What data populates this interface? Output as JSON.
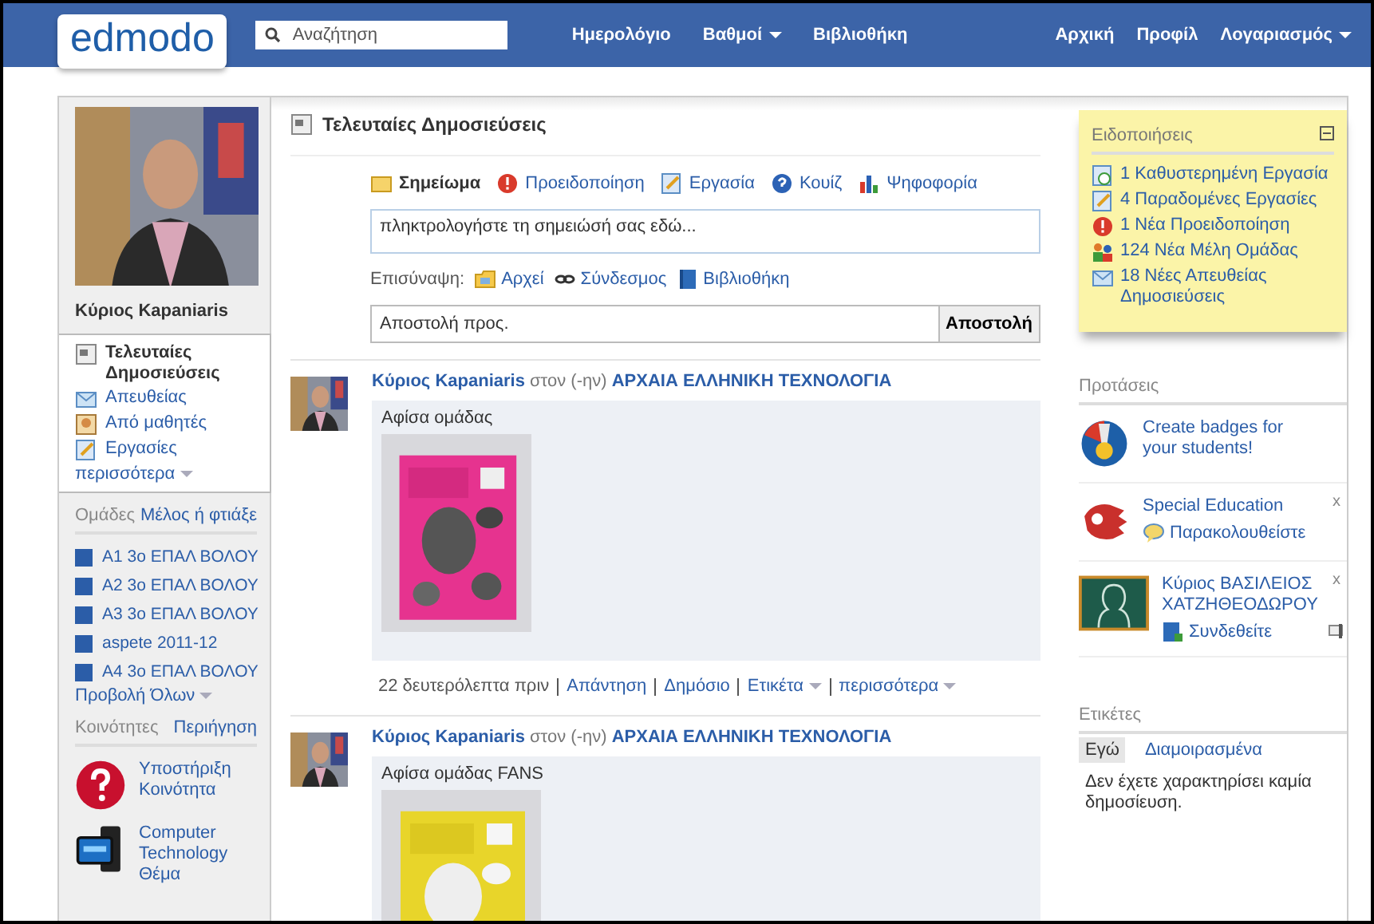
{
  "top_bar": {
    "logo": "edmodo",
    "search": {
      "placeholder": "Αναζήτηση"
    },
    "nav_left": [
      {
        "label": "Ημερολόγιο",
        "dropdown": false
      },
      {
        "label": "Βαθμοί",
        "dropdown": true
      },
      {
        "label": "Βιβλιοθήκη",
        "dropdown": false
      }
    ],
    "nav_right": [
      {
        "label": "Αρχική",
        "dropdown": false
      },
      {
        "label": "Προφίλ",
        "dropdown": false
      },
      {
        "label": "Λογαριασμός",
        "dropdown": true
      }
    ]
  },
  "profile": {
    "name": "Κύριος Kapaniaris"
  },
  "sidebar": {
    "items": [
      {
        "label": "Τελευταίες Δημοσιεύσεις",
        "selected": true,
        "kind": "feed"
      },
      {
        "label": "Απευθείας",
        "selected": false,
        "kind": "mail"
      },
      {
        "label": "Από μαθητές",
        "selected": false,
        "kind": "student"
      },
      {
        "label": "Εργασίες",
        "selected": false,
        "kind": "assignment"
      }
    ],
    "more": "περισσότερα"
  },
  "groups": {
    "title": "Ομάδες",
    "action": "Μέλος ή φτιάξε",
    "items": [
      {
        "name": "Α1 3ο ΕΠΑΛ ΒΟΛΟΥ"
      },
      {
        "name": "Α2 3ο ΕΠΑΛ ΒΟΛΟΥ"
      },
      {
        "name": "Α3 3ο ΕΠΑΛ ΒΟΛΟΥ"
      },
      {
        "name": "aspete 2011-12"
      },
      {
        "name": "Α4 3ο ΕΠΑΛ ΒΟΛΟΥ"
      }
    ],
    "view_all": "Προβολή Όλων"
  },
  "communities": {
    "title": "Κοινότητες",
    "action": "Περιήγηση",
    "items": [
      {
        "name": "Υποστήριξη Κοινότητα",
        "kind": "help"
      },
      {
        "name": "Computer Technology",
        "subtitle": "Θέμα",
        "kind": "computer"
      }
    ]
  },
  "composer": {
    "title": "Τελευταίες Δημοσιεύσεις",
    "tabs": [
      {
        "label": "Σημείωμα",
        "selected": true,
        "kind": "note"
      },
      {
        "label": "Προειδοποίηση",
        "selected": false,
        "kind": "alert"
      },
      {
        "label": "Εργασία",
        "selected": false,
        "kind": "assignment"
      },
      {
        "label": "Κουίζ",
        "selected": false,
        "kind": "quiz"
      },
      {
        "label": "Ψηφοφορία",
        "selected": false,
        "kind": "poll"
      }
    ],
    "placeholder": "πληκτρολογήστε τη σημειώσή σας εδώ...",
    "attach_label": "Επισύναψη:",
    "attachments": [
      {
        "label": "Αρχεί",
        "kind": "file"
      },
      {
        "label": "Σύνδεσμος",
        "kind": "link"
      },
      {
        "label": "Βιβλιοθήκη",
        "kind": "library"
      }
    ],
    "recipient_placeholder": "Αποστολή προς.",
    "send": "Αποστολή"
  },
  "posts": [
    {
      "author": "Κύριος Kapaniaris",
      "connector": "στον (-ην)",
      "group": "ΑΡΧΑΙΑ ΕΛΛΗΝΙΚΗ ΤΕΧΝΟΛΟΓΙΑ",
      "text": "Αφίσα ομάδας",
      "time": "22 δευτερόλεπτα πριν",
      "actions": [
        {
          "label": "Απάντηση",
          "dropdown": false
        },
        {
          "label": "Δημόσιο",
          "dropdown": false
        },
        {
          "label": "Ετικέτα",
          "dropdown": true
        },
        {
          "label": "περισσότερα",
          "dropdown": true
        }
      ]
    },
    {
      "author": "Κύριος Kapaniaris",
      "connector": "στον (-ην)",
      "group": "ΑΡΧΑΙΑ ΕΛΛΗΝΙΚΗ ΤΕΧΝΟΛΟΓΙΑ",
      "text": "Αφίσα ομάδας FANS"
    }
  ],
  "notifications": {
    "title": "Ειδοποιήσεις",
    "items": [
      {
        "label": "1 Καθυστερημένη Εργασία",
        "kind": "late"
      },
      {
        "label": "4 Παραδομένες Εργασίες",
        "kind": "assignment"
      },
      {
        "label": "1 Νέα Προειδοποίηση",
        "kind": "alert"
      },
      {
        "label": "124 Νέα Μέλη Ομάδας",
        "kind": "members"
      },
      {
        "label": "18 Νέες Απευθείας Δημοσιεύσεις",
        "kind": "mail"
      }
    ]
  },
  "suggestions": {
    "title": "Προτάσεις",
    "items": [
      {
        "title": "Create badges for your students!",
        "kind": "badge"
      },
      {
        "title": "Special Education",
        "action": "Παρακολουθείστε",
        "kind": "community",
        "dismiss": "x"
      },
      {
        "title": "Κύριος ΒΑΣΙΛΕΙΟΣ ΧΑΤΖΗΘΕΟΔΩΡΟΥ",
        "action": "Συνδεθείτε",
        "kind": "person",
        "dismiss": "x",
        "flag": true
      }
    ]
  },
  "tags": {
    "title": "Ετικέτες",
    "tabs": [
      {
        "label": "Εγώ",
        "selected": true
      },
      {
        "label": "Διαμοιρασμένα",
        "selected": false
      }
    ],
    "empty": "Δεν έχετε χαρακτηρίσει καμία δημοσίευση."
  }
}
